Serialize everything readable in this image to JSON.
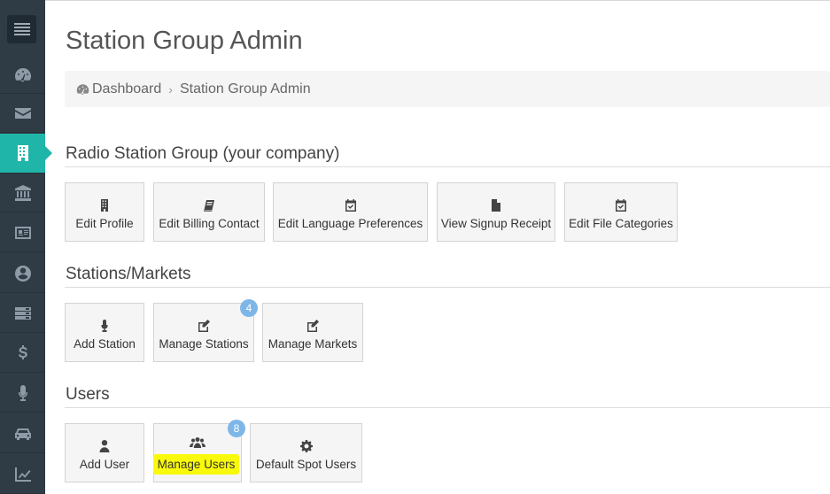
{
  "page": {
    "title": "Station Group Admin"
  },
  "breadcrumb": {
    "home": "Dashboard",
    "separator": "›",
    "current": "Station Group Admin"
  },
  "sidebar": {
    "items": [
      {
        "icon": "menu-icon"
      },
      {
        "icon": "dashboard-icon"
      },
      {
        "icon": "envelope-icon"
      },
      {
        "icon": "building-icon",
        "active": true
      },
      {
        "icon": "bank-icon"
      },
      {
        "icon": "id-card-icon"
      },
      {
        "icon": "user-circle-icon"
      },
      {
        "icon": "server-icon"
      },
      {
        "icon": "dollar-icon"
      },
      {
        "icon": "microphone-icon"
      },
      {
        "icon": "car-icon"
      },
      {
        "icon": "chart-line-icon"
      }
    ],
    "active_color": "#1fb5a9",
    "bg_color": "#2f3b45"
  },
  "sections": {
    "group": {
      "title": "Radio Station Group (your company)",
      "tiles": [
        {
          "label": "Edit Profile",
          "icon": "building-icon"
        },
        {
          "label": "Edit Billing Contact",
          "icon": "book-icon"
        },
        {
          "label": "Edit Language Preferences",
          "icon": "calendar-check-icon"
        },
        {
          "label": "View Signup Receipt",
          "icon": "file-icon"
        },
        {
          "label": "Edit File Categories",
          "icon": "calendar-check-icon"
        }
      ]
    },
    "stations": {
      "title": "Stations/Markets",
      "tiles": [
        {
          "label": "Add Station",
          "icon": "microphone-icon"
        },
        {
          "label": "Manage Stations",
          "icon": "edit-icon",
          "badge": "4"
        },
        {
          "label": "Manage Markets",
          "icon": "edit-icon"
        }
      ]
    },
    "users": {
      "title": "Users",
      "tiles": [
        {
          "label": "Add User",
          "icon": "user-icon"
        },
        {
          "label": "Manage Users",
          "icon": "users-icon",
          "badge": "8",
          "highlighted": true
        },
        {
          "label": "Default Spot Users",
          "icon": "gear-icon"
        }
      ]
    }
  },
  "colors": {
    "badge": "#7eb6e8",
    "highlight": "#f9f90a"
  }
}
